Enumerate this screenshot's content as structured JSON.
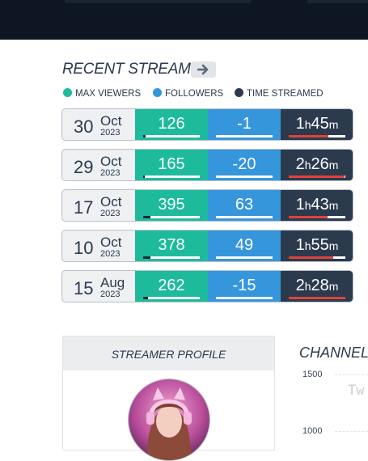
{
  "recent_streams": {
    "title": "RECENT STREAMS",
    "legend": [
      {
        "label": "MAX VIEWERS",
        "color": "#1dbb9c"
      },
      {
        "label": "FOLLOWERS",
        "color": "#3596dc"
      },
      {
        "label": "TIME STREAMED",
        "color": "#2c3a4e"
      }
    ],
    "rows": [
      {
        "day": "30",
        "month": "Oct",
        "year": "2023",
        "viewers": "126",
        "followers": "-1",
        "hours": "1",
        "minutes": "45",
        "viewers_level": 0.04,
        "time_level": 0.7
      },
      {
        "day": "29",
        "month": "Oct",
        "year": "2023",
        "viewers": "165",
        "followers": "-20",
        "hours": "2",
        "minutes": "26",
        "viewers_level": 0.0,
        "time_level": 0.98
      },
      {
        "day": "17",
        "month": "Oct",
        "year": "2023",
        "viewers": "395",
        "followers": "63",
        "hours": "1",
        "minutes": "43",
        "viewers_level": 0.13,
        "time_level": 0.69
      },
      {
        "day": "10",
        "month": "Oct",
        "year": "2023",
        "viewers": "378",
        "followers": "49",
        "hours": "1",
        "minutes": "55",
        "viewers_level": 0.13,
        "time_level": 0.78
      },
      {
        "day": "15",
        "month": "Aug",
        "year": "2023",
        "viewers": "262",
        "followers": "-15",
        "hours": "2",
        "minutes": "28",
        "viewers_level": 0.09,
        "time_level": 1.0
      }
    ]
  },
  "profile": {
    "title": "STREAMER PROFILE"
  },
  "channel": {
    "title": "CHANNEL",
    "y_ticks": [
      "1500",
      "1000"
    ],
    "watermark": "Tw"
  }
}
